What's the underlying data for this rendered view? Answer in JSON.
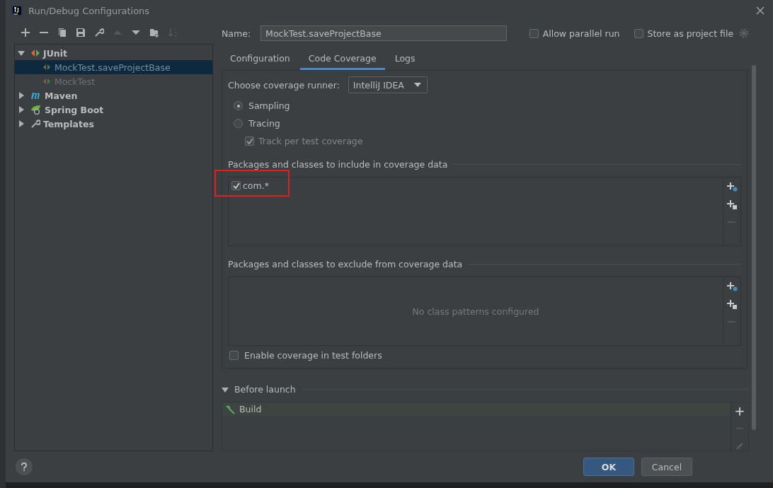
{
  "window": {
    "title": "Run/Debug Configurations"
  },
  "toolbar": [
    {
      "kind": "add",
      "disabled": false
    },
    {
      "kind": "remove",
      "disabled": false
    },
    {
      "kind": "copy",
      "disabled": false
    },
    {
      "kind": "save",
      "disabled": false
    },
    {
      "kind": "edit",
      "disabled": false
    },
    {
      "kind": "up",
      "disabled": true
    },
    {
      "kind": "down",
      "disabled": false
    },
    {
      "kind": "folder",
      "disabled": false
    },
    {
      "kind": "sort",
      "disabled": true
    }
  ],
  "tree": [
    {
      "label": "JUnit",
      "kind": "junit",
      "expanded": true,
      "selected": false,
      "children": [
        {
          "label": "MockTest.saveProjectBase",
          "kind": "test",
          "selected": true
        },
        {
          "label": "MockTest",
          "kind": "test",
          "selected": false
        }
      ]
    },
    {
      "label": "Maven",
      "kind": "maven",
      "expanded": false,
      "selected": false
    },
    {
      "label": "Spring Boot",
      "kind": "spring",
      "expanded": false,
      "selected": false
    },
    {
      "label": "Templates",
      "kind": "templates",
      "expanded": false,
      "selected": false
    }
  ],
  "name_field": {
    "label": "Name:",
    "value": "MockTest.saveProjectBase"
  },
  "options": [
    {
      "label": "Allow parallel run",
      "checked": false
    },
    {
      "label": "Store as project file",
      "checked": false
    }
  ],
  "tabs": [
    {
      "label": "Configuration",
      "selected": false
    },
    {
      "label": "Code Coverage",
      "selected": true
    },
    {
      "label": "Logs",
      "selected": false
    }
  ],
  "coverage": {
    "runner_label": "Choose coverage runner:",
    "runner": "IntelliJ IDEA",
    "modes": [
      {
        "label": "Sampling",
        "selected": true
      },
      {
        "label": "Tracing",
        "selected": false
      }
    ],
    "track": {
      "label": "Track per test coverage",
      "checked": true,
      "disabled": true
    },
    "include": {
      "title": "Packages and classes to include in coverage data",
      "patterns": [
        {
          "label": "com.*",
          "checked": true,
          "highlighted": true
        }
      ]
    },
    "exclude": {
      "title": "Packages and classes to exclude from coverage data",
      "empty_text": "No class patterns configured"
    },
    "test_folders": {
      "label": "Enable coverage in test folders",
      "checked": false
    }
  },
  "before_launch": {
    "title": "Before launch",
    "expanded": true,
    "tasks": [
      {
        "label": "Build"
      }
    ]
  },
  "buttons": [
    {
      "label": "OK",
      "kind": "primary"
    },
    {
      "label": "Cancel",
      "kind": "secondary"
    }
  ]
}
